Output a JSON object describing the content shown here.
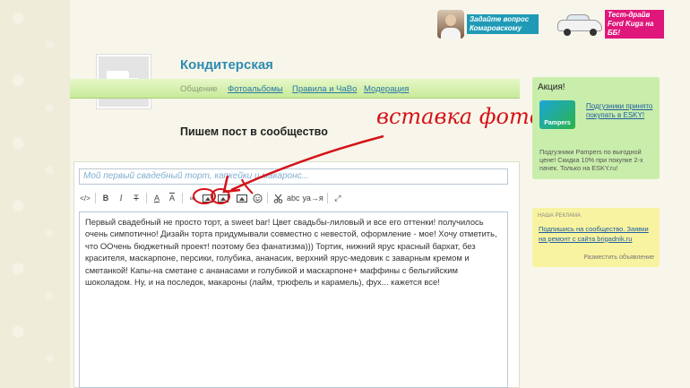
{
  "promos": [
    {
      "label": "Задайте вопрос Комаровскому",
      "image": "doctor-avatar"
    },
    {
      "label": "Тест-драйв Ford Kuga на ББ!",
      "image": "car"
    }
  ],
  "community": {
    "title": "Кондитерская",
    "nav": [
      {
        "label": "Общение",
        "active": true
      },
      {
        "label": "Фотоальбомы",
        "active": false
      },
      {
        "label": "Правила и ЧаВо",
        "active": false
      },
      {
        "label": "Модерация",
        "active": false
      }
    ]
  },
  "post": {
    "heading": "Пишем пост в сообщество",
    "title_value": "Мой первый свадебный торт, капкейки и макаронс...",
    "body": "Первый свадебный не просто торт, а sweet bar! Цвет свадьбы-лиловый и все его оттенки! получилось очень симпотично! Дизайн торта придумывали совместно с невестой, оформление - мое! Хочу отметить, что ООчень бюджетный проект! поэтому без фанатизма))) Тортик, нижний ярус красный бархат, без красителя, маскарпоне, персики, голубика, ананасик, верхний ярус-медовик с заварным кремом и сметанкой! Капы-на сметане с ананасами и голубикой и маскарпоне+ маффины с бельгийским шоколадом. Ну, и на последок, макароны (лайм, трюфель и карамель), фух... кажется все!"
  },
  "toolbar": {
    "html": "</>",
    "bold": "B",
    "italic": "I",
    "strike": "T",
    "font_color": "A",
    "clear_format": "A",
    "link": "∞",
    "spellcheck": "abc",
    "translit": "уа→я",
    "fullscreen": "⤢"
  },
  "annotation": {
    "text": "вставка фото",
    "color": "#d41319"
  },
  "sidebar": {
    "aktsiya_title": "Акция!",
    "pampers_brand": "Pampers",
    "pampers_link": "Подгузники принято покупать в ESKY!",
    "pampers_desc": "Подгузники Pampers по выгодной цене! Скидка 10% при покупке 2-х пачек. Только на ESKY.ru!",
    "ad_label": "наша реклама",
    "ad_link": "Подпишись на сообщество. Заявки на ремонт с сайта brigadnik.ru",
    "ad_place": "Разместить объявление"
  },
  "colors": {
    "link": "#2b78a8",
    "nav_green": "#c8ea99",
    "aktsiya_green": "#c9edab",
    "ad_yellow": "#f8f3a0"
  }
}
